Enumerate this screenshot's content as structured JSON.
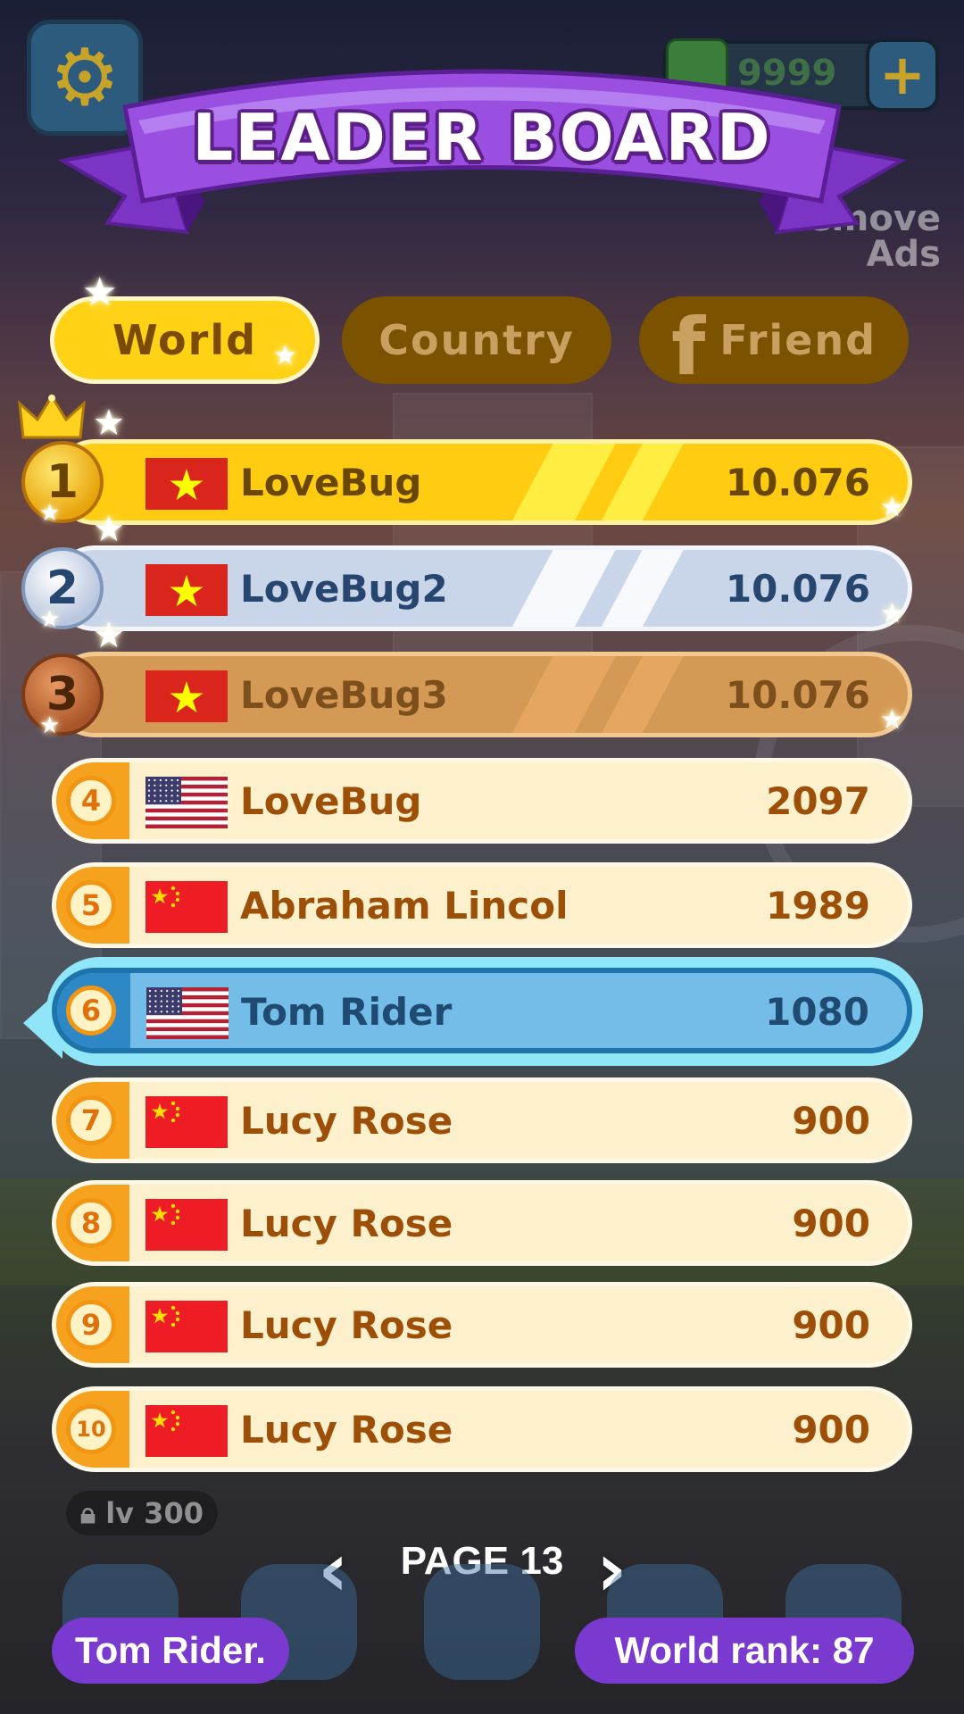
{
  "header": {
    "title": "LEADER BOARD",
    "coins": "9999",
    "background_side_text": [
      "Remove",
      "Ads"
    ]
  },
  "tabs": [
    {
      "label": "World",
      "active": true
    },
    {
      "label": "Country",
      "active": false
    },
    {
      "label": "Friend",
      "active": false,
      "icon": "facebook-icon"
    }
  ],
  "leaderboard": [
    {
      "rank": "1",
      "flag": "vietnam",
      "name": "LoveBug",
      "score": "10.076",
      "style": "gold"
    },
    {
      "rank": "2",
      "flag": "vietnam",
      "name": "LoveBug2",
      "score": "10.076",
      "style": "silver"
    },
    {
      "rank": "3",
      "flag": "vietnam",
      "name": "LoveBug3",
      "score": "10.076",
      "style": "bronze"
    },
    {
      "rank": "4",
      "flag": "usa",
      "name": "LoveBug",
      "score": "2097",
      "style": "normal"
    },
    {
      "rank": "5",
      "flag": "china",
      "name": "Abraham Lincol",
      "score": "1989",
      "style": "normal"
    },
    {
      "rank": "6",
      "flag": "usa",
      "name": "Tom Rider",
      "score": "1080",
      "style": "mine"
    },
    {
      "rank": "7",
      "flag": "china",
      "name": "Lucy Rose",
      "score": "900",
      "style": "normal"
    },
    {
      "rank": "8",
      "flag": "china",
      "name": "Lucy Rose",
      "score": "900",
      "style": "normal"
    },
    {
      "rank": "9",
      "flag": "china",
      "name": "Lucy Rose",
      "score": "900",
      "style": "normal"
    },
    {
      "rank": "10",
      "flag": "china",
      "name": "Lucy Rose",
      "score": "900",
      "style": "normal"
    }
  ],
  "pagination": {
    "label": "PAGE 13",
    "prev_icon": "chevron-left-icon",
    "next_icon": "chevron-right-icon"
  },
  "background": {
    "lock_level": "lv 300"
  },
  "footer": {
    "player_name": "Tom Rider.",
    "world_rank": "World rank: 87"
  },
  "colors": {
    "banner_purple": "#9b4fe0",
    "gold_row": "#ffcc12",
    "silver_row": "#c9d6ea",
    "bronze_row": "#d49a55",
    "normal_row": "#fdf0cc",
    "mine_row": "#74bde9",
    "pill_purple": "#7a3ad0",
    "tab_inactive": "#7a5200",
    "tab_active": "#ffd216"
  }
}
